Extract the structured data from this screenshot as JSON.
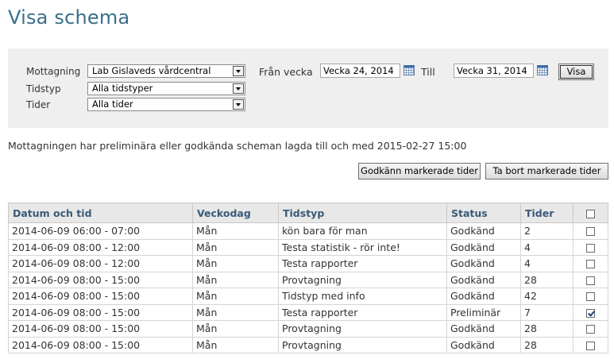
{
  "page": {
    "title": "Visa schema"
  },
  "filters": {
    "mottagning_label": "Mottagning",
    "mottagning_value": "Lab Gislaveds vårdcentral",
    "tidstyp_label": "Tidstyp",
    "tidstyp_value": "Alla tidstyper",
    "tider_label": "Tider",
    "tider_value": "Alla tider",
    "from_week_label": "Från vecka",
    "from_week_value": "Vecka 24, 2014",
    "to_week_label": "Till",
    "to_week_value": "Vecka 31, 2014",
    "show_button": "Visa"
  },
  "info": "Mottagningen har preliminära eller godkända scheman lagda till och med 2015-02-27 15:00",
  "actions": {
    "approve": "Godkänn markerade tider",
    "delete": "Ta bort markerade tider"
  },
  "table": {
    "headers": [
      "Datum och tid",
      "Veckodag",
      "Tidstyp",
      "Status",
      "Tider"
    ],
    "rows": [
      {
        "datetime": "2014-06-09 06:00 - 07:00",
        "day": "Mån",
        "type": "kön bara för man",
        "status": "Godkänd",
        "count": "2",
        "checked": false
      },
      {
        "datetime": "2014-06-09 08:00 - 12:00",
        "day": "Mån",
        "type": "Testa statistik - rör inte!",
        "status": "Godkänd",
        "count": "4",
        "checked": false
      },
      {
        "datetime": "2014-06-09 08:00 - 12:00",
        "day": "Mån",
        "type": "Testa rapporter",
        "status": "Godkänd",
        "count": "4",
        "checked": false
      },
      {
        "datetime": "2014-06-09 08:00 - 15:00",
        "day": "Mån",
        "type": "Provtagning",
        "status": "Godkänd",
        "count": "28",
        "checked": false
      },
      {
        "datetime": "2014-06-09 08:00 - 15:00",
        "day": "Mån",
        "type": "Tidstyp med info",
        "status": "Godkänd",
        "count": "42",
        "checked": false
      },
      {
        "datetime": "2014-06-09 08:00 - 15:00",
        "day": "Mån",
        "type": "Testa rapporter",
        "status": "Preliminär",
        "count": "7",
        "checked": true
      },
      {
        "datetime": "2014-06-09 08:00 - 15:00",
        "day": "Mån",
        "type": "Provtagning",
        "status": "Godkänd",
        "count": "28",
        "checked": false
      },
      {
        "datetime": "2014-06-09 08:00 - 15:00",
        "day": "Mån",
        "type": "Provtagning",
        "status": "Godkänd",
        "count": "28",
        "checked": false
      }
    ]
  }
}
